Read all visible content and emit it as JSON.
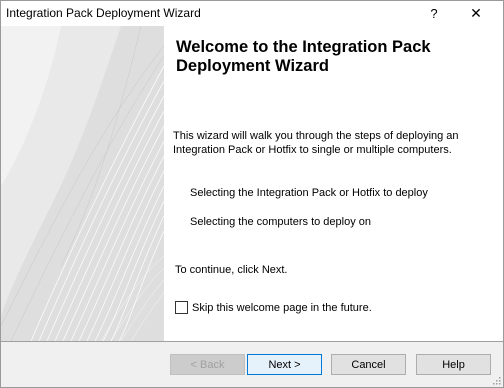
{
  "window": {
    "title": "Integration Pack Deployment Wizard",
    "help_glyph": "?",
    "close_glyph": "✕"
  },
  "content": {
    "heading": "Welcome to the Integration Pack Deployment Wizard",
    "intro": "This wizard will walk you through the steps of deploying an Integration Pack or Hotfix to single or multiple computers.",
    "steps": [
      "Selecting the Integration Pack or Hotfix to deploy",
      "Selecting the computers to deploy on"
    ],
    "continue_text": "To continue, click Next.",
    "skip_label": "Skip this welcome page in the future.",
    "skip_checked": false
  },
  "footer": {
    "back_label": "< Back",
    "next_label": "Next >",
    "cancel_label": "Cancel",
    "help_label": "Help"
  },
  "colors": {
    "side_panel": "#dcdcdc",
    "footer": "#f0f0f0",
    "default_button_border": "#0078d7"
  }
}
